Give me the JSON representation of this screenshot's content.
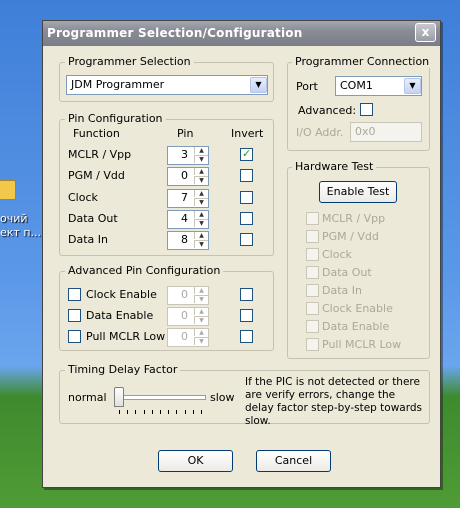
{
  "desktop": {
    "icon_label_1": "очий",
    "icon_label_2": "ект п..."
  },
  "window": {
    "title": "Programmer Selection/Configuration",
    "close_glyph": "x"
  },
  "programmer_selection": {
    "title": "Programmer Selection",
    "selected": "JDM Programmer"
  },
  "pin_config": {
    "title": "Pin Configuration",
    "col_function": "Function",
    "col_pin": "Pin",
    "col_invert": "Invert",
    "rows": [
      {
        "function": "MCLR / Vpp",
        "pin": "3",
        "invert": true
      },
      {
        "function": "PGM / Vdd",
        "pin": "0",
        "invert": false
      },
      {
        "function": "Clock",
        "pin": "7",
        "invert": false
      },
      {
        "function": "Data Out",
        "pin": "4",
        "invert": false
      },
      {
        "function": "Data In",
        "pin": "8",
        "invert": false
      }
    ]
  },
  "advanced_pin": {
    "title": "Advanced Pin Configuration",
    "rows": [
      {
        "label": "Clock Enable",
        "pin": "0"
      },
      {
        "label": "Data Enable",
        "pin": "0"
      },
      {
        "label": "Pull MCLR Low",
        "pin": "0"
      }
    ]
  },
  "programmer_connection": {
    "title": "Programmer Connection",
    "port_label": "Port",
    "port_value": "COM1",
    "advanced_label": "Advanced:",
    "io_label": "I/O Addr.",
    "io_value": "0x0"
  },
  "hardware_test": {
    "title": "Hardware Test",
    "enable_button": "Enable Test",
    "items": [
      "MCLR / Vpp",
      "PGM / Vdd",
      "Clock",
      "Data Out",
      "Data In",
      "Clock Enable",
      "Data Enable",
      "Pull MCLR Low"
    ]
  },
  "timing": {
    "title": "Timing Delay Factor",
    "left_label": "normal",
    "right_label": "slow",
    "slider_position": 0,
    "help_text": "If the PIC is not detected or there are verify errors, change the delay factor step-by-step towards slow."
  },
  "buttons": {
    "ok": "OK",
    "cancel": "Cancel"
  }
}
